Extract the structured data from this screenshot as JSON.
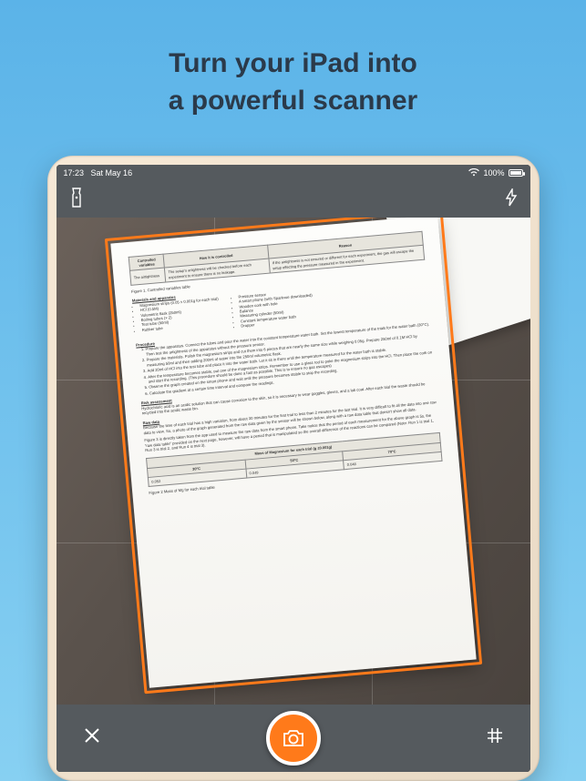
{
  "marketing": {
    "headline_line1": "Turn your iPad into",
    "headline_line2": "a powerful scanner"
  },
  "status_bar": {
    "time": "17:23",
    "date": "Sat May 16",
    "battery_percent": "100%"
  },
  "document": {
    "table1": {
      "headers": [
        "Controlled variables",
        "How it is controlled",
        "Reason"
      ],
      "row": [
        "The airtightness",
        "The setup's artightness will be checked before each experiment to ensure there is no leakage.",
        "If the airtightness is not ensured or different for each experiment, the gas will escape the setup effecting the pressure measured in the experiment."
      ],
      "caption": "Figure 1. Controlled variables table"
    },
    "materials_title": "Materials and apparatus",
    "materials_left": [
      "Magnesium strips (0.05 ± 0.001g for each trial)",
      "HCl (0.5M)",
      "Volumetric flask (250ml)",
      "Boiling tubes (× 2)",
      "Test tube (50ml)",
      "Rubber tube"
    ],
    "materials_right": [
      "Pressure sensor",
      "A smart phone (with Sparkvue downloaded)",
      "Wooden cork with hole",
      "Balance",
      "Measuring cylinder (50ml)",
      "Constant temperature water bath",
      "Dropper"
    ],
    "procedure_title": "Procedure",
    "procedure": [
      "Prepare the apparatus. Connect the tubes and pour the water into the constant temperature water bath. Set the lowest temperature of the trials for the water bath (30°C). Then test the artightness of the apparatus without the pressure sensor.",
      "Prepare the materials. Polish the magnesium strips and cut them into 6 pieces that are nearly the same size while weighing 0.05g. Prepare 250ml of 0.1M HCl by measuring 50ml and then adding 200ml of water into the 250ml volumetric flask.",
      "Add 20ml of HCl into the test tube and place it into the water bath. Let it sit in there until the temperature measured for the water bath is stable.",
      "After the temperature becomes stable, put one of the magnesium strips. Remember to use a glass rod to poke the magnesium strips into the HCl. Then place the cork on and start the recording. (This procedure should be done a fast as possible. This is to ensure no gas escapes)",
      "Observe the graph created on the smart phone and wait until the pressure becomes stable to stop the recording.",
      "Calculate the gradient at a certain time interval and compare the readings."
    ],
    "risk_title": "Risk assessment",
    "risk_text": "Hydrochloric acid is an acidic solution that can cause corrosion to the skin, so it is necessary to wear goggles, gloves, and a lab coat. After each trial the waste should be recycled into the acidic waste bin.",
    "rawdata_title": "Raw data",
    "rawdata_text": "Because the time of each trial has a high variation, from about 30 minutes for the first trial to less than 2 minutes for the last trial. It is very difficult to fit all the data into one raw data to view. So, a photo of the graph generated from the raw data given by the sensor will be shown below, along with a raw data table that doesn't show all data.",
    "rawdata_text2": "Figure 3 is directly taken from the app used to measure the raw data from the smart phone. Take notice that the period of each measurement for the above graph is 5s, the \"raw data table\" provided on the next page, however, will have a period that is manipulated so the overall difference of the reactions can be compared (Note: Run 1 is trial 1, Run 3 is trial 2, and Run 4 is trial 3).",
    "table2": {
      "header_span": "Mass of Magnesium for each trial (g ±0.001g)",
      "cols": [
        "30°C",
        "50°C",
        "70°C"
      ],
      "vals": [
        "0.052",
        "0.049",
        "0.048"
      ],
      "caption": "Figure 2 Mass of Mg for each trial table"
    }
  }
}
